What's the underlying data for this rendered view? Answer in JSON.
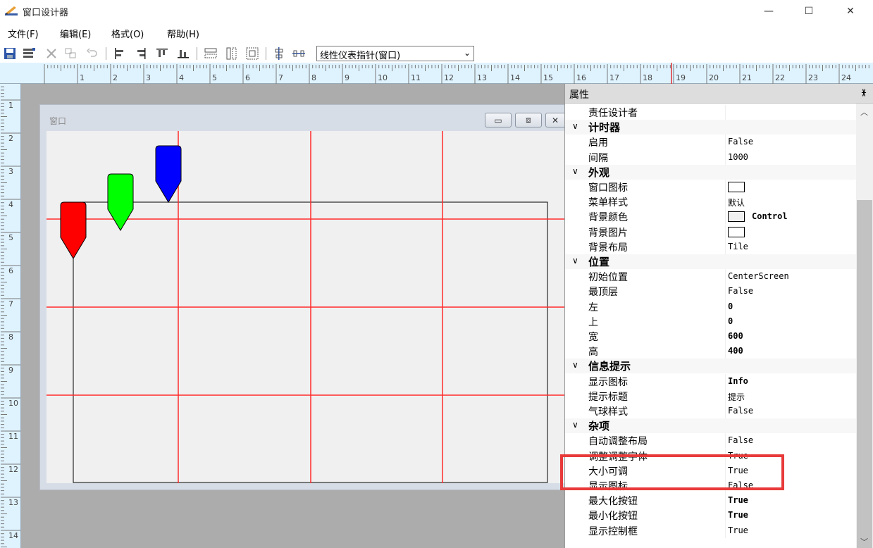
{
  "window": {
    "title": "窗口设计器",
    "min_glyph": "—",
    "max_glyph": "☐",
    "close_glyph": "✕"
  },
  "menu": [
    "文件(F)",
    "编辑(E)",
    "格式(O)",
    "帮助(H)"
  ],
  "toolbar": {
    "combo_value": "线性仪表指针(窗口)"
  },
  "ruler": {
    "h_numbers": [
      "1",
      "2",
      "3",
      "4",
      "5",
      "6",
      "7",
      "8",
      "9",
      "10",
      "11",
      "12",
      "13",
      "14",
      "15",
      "16",
      "17",
      "18",
      "19",
      "20",
      "21",
      "22",
      "23",
      "24"
    ],
    "v_numbers": [
      "1",
      "2",
      "3",
      "4",
      "5",
      "6",
      "7",
      "8",
      "9",
      "10",
      "11",
      "12",
      "13",
      "14"
    ]
  },
  "designer": {
    "form_title": "窗口",
    "pointer_colors": [
      "#ff0000",
      "#00ff00",
      "#0000ff"
    ],
    "grid_line_color": "#ff2a2a"
  },
  "properties": {
    "header": "属性",
    "pin": "ᴨ",
    "top_row": {
      "name": "责任设计者",
      "value": ""
    },
    "categories": [
      {
        "name": "计时器",
        "rows": [
          {
            "name": "启用",
            "value": "False"
          },
          {
            "name": "间隔",
            "value": "1000"
          }
        ]
      },
      {
        "name": "外观",
        "rows": [
          {
            "name": "窗口图标",
            "value": "",
            "swatch": "#ffffff"
          },
          {
            "name": "菜单样式",
            "value": "默认"
          },
          {
            "name": "背景颜色",
            "value": "Control",
            "swatch": "#f0f0f0",
            "bold": true
          },
          {
            "name": "背景图片",
            "value": "",
            "swatch": "#ffffff"
          },
          {
            "name": "背景布局",
            "value": "Tile"
          }
        ]
      },
      {
        "name": "位置",
        "rows": [
          {
            "name": "初始位置",
            "value": "CenterScreen"
          },
          {
            "name": "最顶层",
            "value": "False"
          },
          {
            "name": "左",
            "value": "0",
            "bold": true
          },
          {
            "name": "上",
            "value": "0",
            "bold": true
          },
          {
            "name": "宽",
            "value": "600",
            "bold": true
          },
          {
            "name": "高",
            "value": "400",
            "bold": true
          }
        ]
      },
      {
        "name": "信息提示",
        "rows": [
          {
            "name": "显示图标",
            "value": "Info",
            "bold": true
          },
          {
            "name": "提示标题",
            "value": "提示"
          },
          {
            "name": "气球样式",
            "value": "False"
          }
        ]
      },
      {
        "name": "杂项",
        "rows": [
          {
            "name": "自动调整布局",
            "value": "False"
          },
          {
            "name": "调整调整字体",
            "value": "True"
          },
          {
            "name": "大小可调",
            "value": "True"
          },
          {
            "name": "显示图标",
            "value": "False"
          },
          {
            "name": "最大化按钮",
            "value": "True",
            "bold": true
          },
          {
            "name": "最小化按钮",
            "value": "True",
            "bold": true
          },
          {
            "name": "显示控制框",
            "value": "True"
          }
        ]
      }
    ]
  }
}
